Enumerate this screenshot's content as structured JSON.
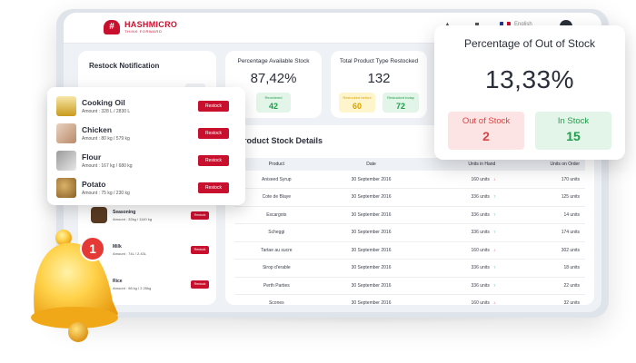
{
  "brand": {
    "name": "HASHMICRO",
    "tagline": "THINK FORWARD",
    "logo_icon": "hash-logo-icon",
    "color": "#c8102e"
  },
  "topbar": {
    "lang_label": "English",
    "icons": [
      "flask-icon",
      "bottle-icon",
      "flag-icon",
      "avatar"
    ]
  },
  "restock_panel": {
    "title": "Restock Notification",
    "background_items": [
      {
        "name": "Seasoning",
        "amount": "Amount : 32kg / 1140 kg",
        "button": "Restock"
      },
      {
        "name": "Milk",
        "amount": "Amount : 74L / 2.43L",
        "button": "Restock"
      },
      {
        "name": "Rice",
        "amount": "Amount : 98 kg / 2.25kg",
        "button": "Restock"
      }
    ]
  },
  "cards": {
    "available": {
      "title": "Percentage Available Stock",
      "value": "87,42%",
      "reordered_label": "Reordered",
      "reordered_value": "42"
    },
    "restocked": {
      "title": "Total Product Type Restocked",
      "value": "132",
      "chip1_label": "Restocked before",
      "chip1_value": "60",
      "chip2_label": "Restocked today",
      "chip2_value": "72"
    }
  },
  "details": {
    "title": "Product Stock Details",
    "columns": [
      "Product",
      "Date",
      "Units in Hand",
      "Units on Order"
    ],
    "rows": [
      {
        "product": "Aniseed Syrup",
        "date": "30 September 2016",
        "hand": "160 units",
        "trend": "down",
        "order": "170 units"
      },
      {
        "product": "Cote de Blaye",
        "date": "30 September 2016",
        "hand": "336 units",
        "trend": "up",
        "order": "125 units"
      },
      {
        "product": "Escargots",
        "date": "30 September 2016",
        "hand": "336 units",
        "trend": "up",
        "order": "14 units"
      },
      {
        "product": "Scheggi",
        "date": "30 September 2016",
        "hand": "336 units",
        "trend": "up",
        "order": "174 units"
      },
      {
        "product": "Tartae au sucre",
        "date": "30 September 2016",
        "hand": "160 units",
        "trend": "down",
        "order": "302 units"
      },
      {
        "product": "Sirop d'erable",
        "date": "30 September 2016",
        "hand": "336 units",
        "trend": "up",
        "order": "18 units"
      },
      {
        "product": "Perth Parties",
        "date": "30 September 2016",
        "hand": "336 units",
        "trend": "up",
        "order": "22 units"
      },
      {
        "product": "Scones",
        "date": "30 September 2016",
        "hand": "160 units",
        "trend": "down",
        "order": "32 units"
      }
    ]
  },
  "restock_popup": {
    "items": [
      {
        "name": "Cooking Oil",
        "amount": "Amount : 328 L / 2830 L",
        "button": "Restock"
      },
      {
        "name": "Chicken",
        "amount": "Amount : 80 kg / 579 kg",
        "button": "Restock"
      },
      {
        "name": "Flour",
        "amount": "Amount : 167 kg / 680 kg",
        "button": "Restock"
      },
      {
        "name": "Potato",
        "amount": "Amount : 75 kg / 230 kg",
        "button": "Restock"
      }
    ]
  },
  "out_of_stock_popup": {
    "title": "Percentage of Out of Stock",
    "value": "13,33%",
    "out_label": "Out of Stock",
    "out_value": "2",
    "in_label": "In Stock",
    "in_value": "15"
  },
  "bell": {
    "badge": "1",
    "icon": "bell-icon"
  },
  "colors": {
    "accent": "#c8102e",
    "green": "#1e9e4a",
    "red": "#d64545",
    "green_bg": "#e3f5e8",
    "red_bg": "#fde4e4",
    "yellow_bg": "#fff5cc",
    "yellow_text": "#d9a400"
  }
}
